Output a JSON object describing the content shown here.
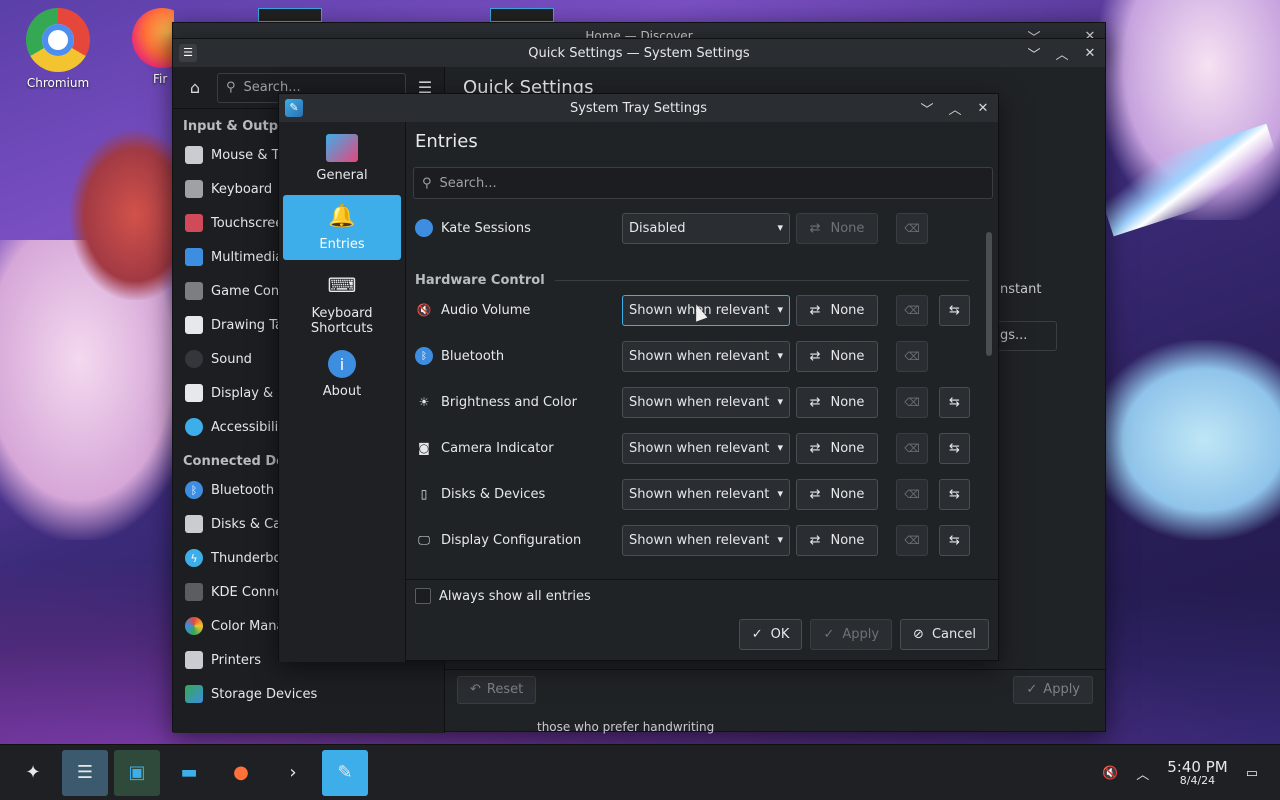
{
  "desktop": {
    "icons": [
      {
        "label": "Chromium"
      },
      {
        "label": "Fir"
      }
    ]
  },
  "discover_window": {
    "title": "Home — Discover"
  },
  "settings_window": {
    "title": "Quick Settings — System Settings",
    "search_placeholder": "Search...",
    "main_title": "Quick Settings",
    "sections": [
      {
        "name": "Input & Output",
        "items": [
          {
            "label": "Mouse & Touchpad",
            "icon": "mouse-icon"
          },
          {
            "label": "Keyboard",
            "icon": "keyboard-icon"
          },
          {
            "label": "Touchscreen",
            "icon": "touchscreen-icon"
          },
          {
            "label": "Multimedia",
            "icon": "multimedia-icon"
          },
          {
            "label": "Game Controller",
            "icon": "gamepad-icon"
          },
          {
            "label": "Drawing Tablet",
            "icon": "tablet-icon"
          },
          {
            "label": "Sound",
            "icon": "sound-icon"
          },
          {
            "label": "Display & Monitor",
            "icon": "display-icon"
          },
          {
            "label": "Accessibility",
            "icon": "accessibility-icon"
          }
        ]
      },
      {
        "name": "Connected Devices",
        "items": [
          {
            "label": "Bluetooth",
            "icon": "bluetooth-icon"
          },
          {
            "label": "Disks & Cameras",
            "icon": "disks-icon"
          },
          {
            "label": "Thunderbolt",
            "icon": "thunderbolt-icon"
          },
          {
            "label": "KDE Connect",
            "icon": "kdeconnect-icon"
          },
          {
            "label": "Color Management",
            "icon": "color-icon"
          },
          {
            "label": "Printers",
            "icon": "printer-icon"
          },
          {
            "label": "Storage Devices",
            "icon": "storage-icon"
          }
        ]
      }
    ],
    "peek_text_1": "nstant",
    "peek_text_2": "gs...",
    "peek_text_3": "those who prefer handwriting",
    "reset_label": "Reset",
    "apply_label": "Apply"
  },
  "tray_dialog": {
    "title": "System Tray Settings",
    "categories": [
      {
        "label": "General",
        "icon": "general-icon",
        "active": false
      },
      {
        "label": "Entries",
        "icon": "bell-icon",
        "active": true
      },
      {
        "label": "Keyboard Shortcuts",
        "icon": "keyboard-icon",
        "active": false
      },
      {
        "label": "About",
        "icon": "info-icon",
        "active": false
      }
    ],
    "heading": "Entries",
    "search_placeholder": "Search...",
    "top_row": {
      "label": "Kate Sessions",
      "visibility": "Disabled",
      "shortcut": "None",
      "icon": "kate-icon"
    },
    "section": "Hardware Control",
    "rows": [
      {
        "label": "Audio Volume",
        "visibility": "Shown when relevant",
        "shortcut": "None",
        "icon": "speaker-muted-icon",
        "configurable": true
      },
      {
        "label": "Bluetooth",
        "visibility": "Shown when relevant",
        "shortcut": "None",
        "icon": "bluetooth-icon",
        "configurable": false
      },
      {
        "label": "Brightness and Color",
        "visibility": "Shown when relevant",
        "shortcut": "None",
        "icon": "brightness-icon",
        "configurable": true
      },
      {
        "label": "Camera Indicator",
        "visibility": "Shown when relevant",
        "shortcut": "None",
        "icon": "camera-icon",
        "configurable": true
      },
      {
        "label": "Disks & Devices",
        "visibility": "Shown when relevant",
        "shortcut": "None",
        "icon": "drive-icon",
        "configurable": true
      },
      {
        "label": "Display Configuration",
        "visibility": "Shown when relevant",
        "shortcut": "None",
        "icon": "monitor-icon",
        "configurable": true
      }
    ],
    "always_show_label": "Always show all entries",
    "ok_label": "OK",
    "apply_label": "Apply",
    "cancel_label": "Cancel"
  },
  "taskbar": {
    "time": "5:40 PM",
    "date": "8/4/24"
  },
  "colors": {
    "accent": "#3daee9",
    "window_bg": "#202326"
  }
}
